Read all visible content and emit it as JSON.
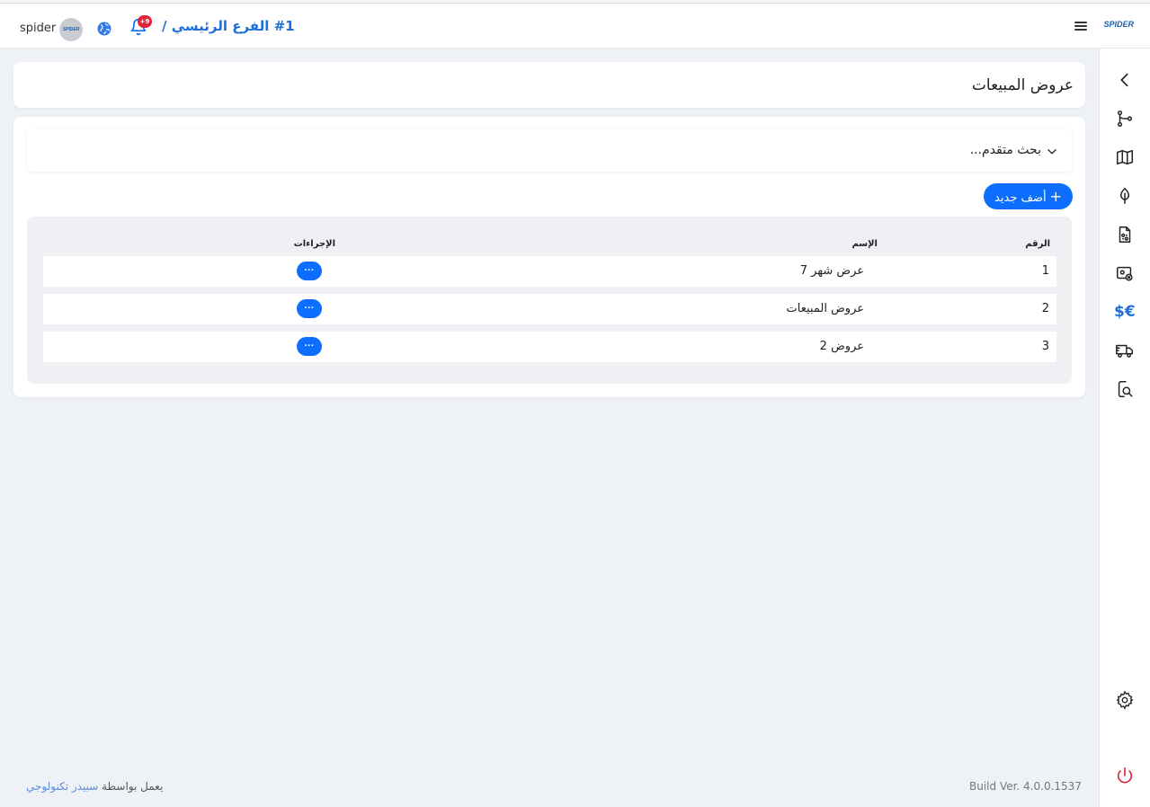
{
  "header": {
    "logo_text": "SPIDER",
    "branch_title": "#1 الفرع الرئيسي /",
    "notification_count": "+9",
    "avatar_text": "SPIDER",
    "username": "spider"
  },
  "page": {
    "title": "عروض المبيعات"
  },
  "search": {
    "label": "بحث متقدم..."
  },
  "toolbar": {
    "add_label": "أضف جديد",
    "add_icon": "+"
  },
  "table": {
    "headers": {
      "number": "الرقم",
      "name": "الإسم",
      "actions": "الإجراءات"
    },
    "rows": [
      {
        "number": "1",
        "name": "عرض شهر 7",
        "action": "···"
      },
      {
        "number": "2",
        "name": "عروض المبيعات",
        "action": "···"
      },
      {
        "number": "3",
        "name": "عروض 2",
        "action": "···"
      }
    ]
  },
  "sidebar": {
    "icons": [
      "chevron-left-icon",
      "git-branch-icon",
      "map-icon",
      "leaf-icon",
      "file-chart-icon",
      "billing-icon",
      "currency-icon",
      "truck-icon",
      "search-doc-icon",
      "gear-icon",
      "power-icon"
    ],
    "currency_glyph": "$€"
  },
  "footer": {
    "powered_by": "يعمل بواسطة",
    "brand": "سبيدر تكنولوجي",
    "build": "Build Ver. 4.0.0.1537"
  },
  "colors": {
    "primary": "#0d6efd",
    "accent_blue": "#1e6fd9",
    "badge_red": "#e0243b",
    "power_red": "#e0243b",
    "background": "#eef1f5"
  }
}
